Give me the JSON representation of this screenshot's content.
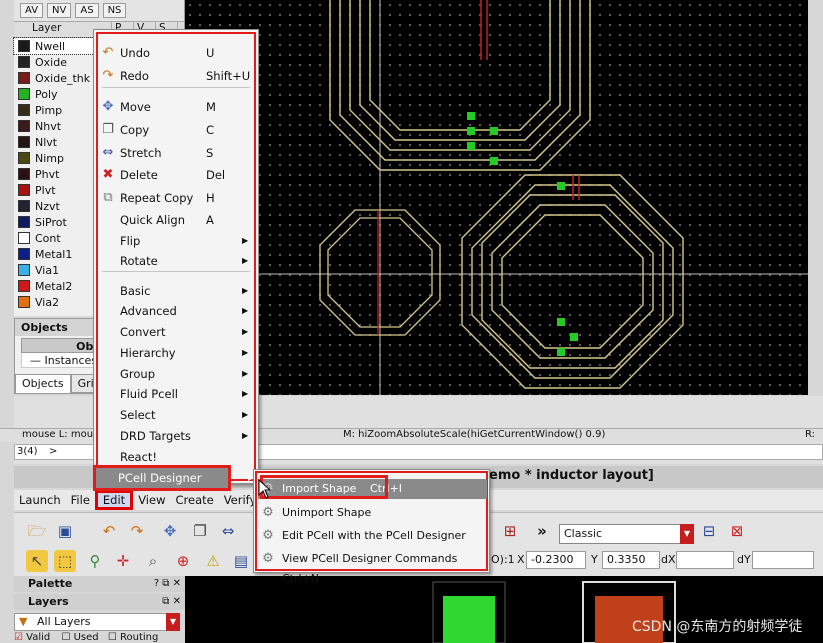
{
  "purpose_tabs": [
    "AV",
    "NV",
    "AS",
    "NS"
  ],
  "layer_table": {
    "header": [
      "Layer",
      "P",
      "V",
      "S"
    ],
    "rows": [
      {
        "name": "Nwell",
        "color": "#1a1a1a"
      },
      {
        "name": "Oxide",
        "color": "#222222"
      },
      {
        "name": "Oxide_thk",
        "color": "#7a1a1a"
      },
      {
        "name": "Poly",
        "color": "#21b321"
      },
      {
        "name": "Pimp",
        "color": "#3a2a1a"
      },
      {
        "name": "Nhvt",
        "color": "#3a1a1a"
      },
      {
        "name": "Nlvt",
        "color": "#251515"
      },
      {
        "name": "Nimp",
        "color": "#4a4a10"
      },
      {
        "name": "Phvt",
        "color": "#2a1111"
      },
      {
        "name": "Plvt",
        "color": "#aa1010"
      },
      {
        "name": "Nzvt",
        "color": "#222233"
      },
      {
        "name": "SiProt",
        "color": "#101a60"
      },
      {
        "name": "Cont",
        "color": "#ffffff"
      },
      {
        "name": "Metal1",
        "color": "#0b1f8a"
      },
      {
        "name": "Via1",
        "color": "#3ab0e8"
      },
      {
        "name": "Metal2",
        "color": "#d01818"
      },
      {
        "name": "Via2",
        "color": "#e07010"
      }
    ]
  },
  "objects_panel": {
    "title": "Objects",
    "header": "Objects",
    "row": "Instances",
    "tabs": [
      "Objects",
      "Grid"
    ]
  },
  "status": {
    "mouse_left": "mouse L: mou",
    "mouse_mid": "M: hiZoomAbsoluteScale(hiGetCurrentWindow() 0.9)",
    "mouse_right": "R:",
    "cmd_prompt": "3(4)",
    "cmd_arrow": ">",
    "window_title": "emo * inductor layout]"
  },
  "menubar": [
    "Launch",
    "File",
    "Edit",
    "View",
    "Create",
    "Verify"
  ],
  "edit_menu": {
    "items": [
      {
        "label": "Undo",
        "shortcut": "U",
        "icon": "undo-icon"
      },
      {
        "label": "Redo",
        "shortcut": "Shift+U",
        "icon": "redo-icon"
      },
      {
        "label": "Move",
        "shortcut": "M",
        "icon": "move-icon"
      },
      {
        "label": "Copy",
        "shortcut": "C",
        "icon": "copy-icon"
      },
      {
        "label": "Stretch",
        "shortcut": "S",
        "icon": "stretch-icon"
      },
      {
        "label": "Delete",
        "shortcut": "Del",
        "icon": "delete-icon"
      },
      {
        "label": "Repeat Copy",
        "shortcut": "H",
        "icon": "repeat-copy-icon"
      },
      {
        "label": "Quick Align",
        "shortcut": "A",
        "icon": ""
      },
      {
        "label": "Flip",
        "shortcut": "",
        "submenu": true
      },
      {
        "label": "Rotate",
        "shortcut": "",
        "submenu": true
      },
      {
        "label": "Basic",
        "shortcut": "",
        "submenu": true
      },
      {
        "label": "Advanced",
        "shortcut": "",
        "submenu": true
      },
      {
        "label": "Convert",
        "shortcut": "",
        "submenu": true
      },
      {
        "label": "Hierarchy",
        "shortcut": "",
        "submenu": true
      },
      {
        "label": "Group",
        "shortcut": "",
        "submenu": true
      },
      {
        "label": "Fluid Pcell",
        "shortcut": "",
        "submenu": true
      },
      {
        "label": "Select",
        "shortcut": "",
        "submenu": true
      },
      {
        "label": "DRD Targets",
        "shortcut": "",
        "submenu": true
      },
      {
        "label": "React!",
        "shortcut": ""
      },
      {
        "label": "PCell Designer",
        "shortcut": "",
        "submenu": true
      }
    ]
  },
  "pcell_submenu": [
    {
      "label": "Import Shape",
      "shortcut": "Ctrl+I"
    },
    {
      "label": "Unimport Shape",
      "shortcut": ""
    },
    {
      "label": "Edit PCell with the PCell Designer",
      "shortcut": ""
    },
    {
      "label": "View PCell Designer Commands Ctrl+N",
      "shortcut": ""
    }
  ],
  "toolbar": {
    "view_mode": "Classic",
    "x_label": "X",
    "x_value": "-0.2300",
    "y_label": "Y",
    "y_value": "0.3350",
    "dx_label": "dX",
    "dy_label": "dY",
    "ratio_label": "O):1"
  },
  "palette": {
    "title": "Palette",
    "layers_title": "Layers",
    "filter": "All Layers",
    "checks": [
      "Valid",
      "Used",
      "Routing"
    ]
  },
  "watermark": "CSDN @东南方的射频学徒",
  "accent_color": "#e21b1b",
  "layout_trace_color": "#d6c88a"
}
